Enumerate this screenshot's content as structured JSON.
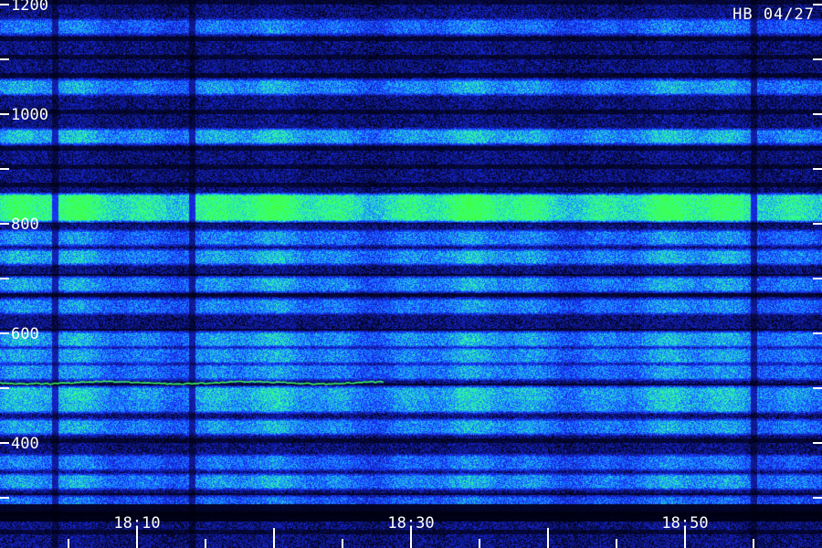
{
  "station_label": "HB 04/27",
  "chart_data": {
    "type": "heatmap",
    "title": "",
    "xlabel": "",
    "ylabel": "",
    "x_range": [
      "18:00",
      "19:00"
    ],
    "ylim": [
      270,
      1200
    ],
    "y_ticks": [
      1200,
      1000,
      800,
      600,
      400
    ],
    "y_minor_ticks": [
      1100,
      900,
      700,
      500,
      300
    ],
    "x_ticks": [
      "18:10",
      "18:30",
      "18:50"
    ],
    "x_minor_tick_interval_minutes": 5,
    "colormap": [
      "#000010",
      "#101890",
      "#1830ff",
      "#1aa0ff",
      "#30ffa0",
      "#40ff40"
    ],
    "bright_bands": [
      {
        "level": 1160,
        "intensity": 0.45
      },
      {
        "level": 1050,
        "intensity": 0.55
      },
      {
        "level": 960,
        "intensity": 0.62
      },
      {
        "level": 830,
        "intensity": 0.95
      },
      {
        "level": 775,
        "intensity": 0.5
      },
      {
        "level": 740,
        "intensity": 0.58
      },
      {
        "level": 690,
        "intensity": 0.55
      },
      {
        "level": 650,
        "intensity": 0.5
      },
      {
        "level": 590,
        "intensity": 0.58
      },
      {
        "level": 560,
        "intensity": 0.55
      },
      {
        "level": 530,
        "intensity": 0.52
      },
      {
        "level": 490,
        "intensity": 0.65
      },
      {
        "level": 470,
        "intensity": 0.6
      },
      {
        "level": 430,
        "intensity": 0.55
      },
      {
        "level": 365,
        "intensity": 0.45
      },
      {
        "level": 330,
        "intensity": 0.55
      },
      {
        "level": 290,
        "intensity": 0.42
      }
    ],
    "narrow_line": {
      "level": 510,
      "color": "#40ff60"
    },
    "data_gaps": [
      "18:04",
      "18:14",
      "18:55"
    ]
  }
}
